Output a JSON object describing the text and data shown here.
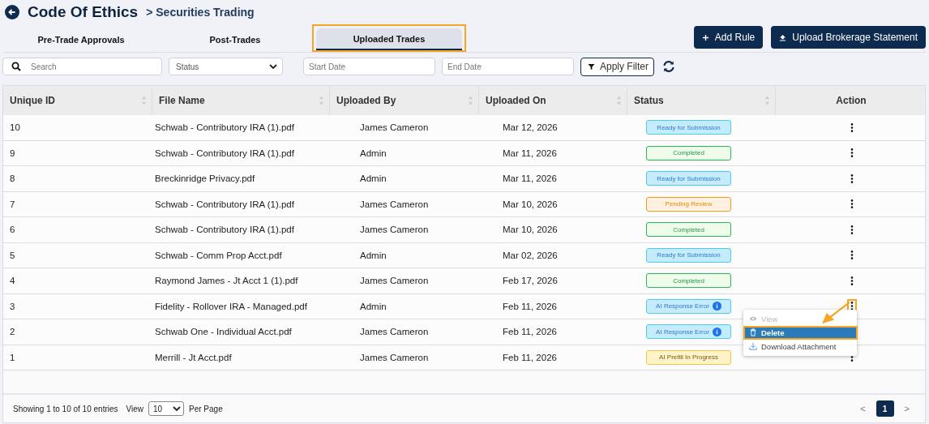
{
  "header": {
    "title": "Code Of Ethics",
    "breadcrumb": "> Securities Trading"
  },
  "tabs": [
    {
      "label": "Pre-Trade Approvals",
      "selected": false,
      "highlighted": false
    },
    {
      "label": "Post-Trades",
      "selected": false,
      "highlighted": false
    },
    {
      "label": "Uploaded Trades",
      "selected": true,
      "highlighted": true
    }
  ],
  "buttons": [
    {
      "kind": "add",
      "label": "Add Rule"
    },
    {
      "kind": "upload",
      "label": "Upload Brokerage Statement"
    }
  ],
  "filters": {
    "search": {
      "placeholder": "Search"
    },
    "status": {
      "value": "Status"
    },
    "start_date": {
      "placeholder": "Start Date"
    },
    "end_date": {
      "placeholder": "End Date"
    },
    "apply": "Apply Filter"
  },
  "table": {
    "columns": [
      {
        "label": "Unique ID",
        "sortable": true
      },
      {
        "label": "File Name",
        "sortable": true
      },
      {
        "label": "Uploaded By",
        "sortable": true
      },
      {
        "label": "Uploaded On",
        "sortable": true
      },
      {
        "label": "Status",
        "sortable": true
      },
      {
        "label": "Action",
        "sortable": false
      }
    ],
    "rows": [
      {
        "id": "10",
        "file": "Schwab - Contributory IRA (1).pdf",
        "by": "James Cameron",
        "on": "Mar 12, 2026",
        "status": {
          "kind": "ready",
          "label": "Ready for Submission"
        },
        "menu_highlighted": false
      },
      {
        "id": "9",
        "file": "Schwab - Contributory IRA (1).pdf",
        "by": "Admin",
        "on": "Mar 11, 2026",
        "status": {
          "kind": "completed",
          "label": "Completed"
        },
        "menu_highlighted": false
      },
      {
        "id": "8",
        "file": "Breckinridge Privacy.pdf",
        "by": "Admin",
        "on": "Mar 11, 2026",
        "status": {
          "kind": "ready",
          "label": "Ready for Submission"
        },
        "menu_highlighted": false
      },
      {
        "id": "7",
        "file": "Schwab - Contributory IRA (1).pdf",
        "by": "James Cameron",
        "on": "Mar 10, 2026",
        "status": {
          "kind": "pending",
          "label": "Pending Review"
        },
        "menu_highlighted": false
      },
      {
        "id": "6",
        "file": "Schwab - Contributory IRA (1).pdf",
        "by": "James Cameron",
        "on": "Mar 10, 2026",
        "status": {
          "kind": "completed",
          "label": "Completed"
        },
        "menu_highlighted": false
      },
      {
        "id": "5",
        "file": "Schwab - Comm Prop Acct.pdf",
        "by": "Admin",
        "on": "Mar 02, 2026",
        "status": {
          "kind": "ready",
          "label": "Ready for Submission"
        },
        "menu_highlighted": false
      },
      {
        "id": "4",
        "file": "Raymond James - Jt Acct 1 (1).pdf",
        "by": "James Cameron",
        "on": "Feb 17, 2026",
        "status": {
          "kind": "completed",
          "label": "Completed"
        },
        "menu_highlighted": false
      },
      {
        "id": "3",
        "file": "Fidelity - Rollover IRA - Managed.pdf",
        "by": "Admin",
        "on": "Feb 11, 2026",
        "status": {
          "kind": "error",
          "label": "AI Response Error"
        },
        "menu_highlighted": true
      },
      {
        "id": "2",
        "file": "Schwab One - Individual Acct.pdf",
        "by": "James Cameron",
        "on": "Feb 11, 2026",
        "status": {
          "kind": "error",
          "label": "AI Response Error"
        }
      },
      {
        "id": "1",
        "file": "Merrill - Jt Acct.pdf",
        "by": "James Cameron",
        "on": "Feb 11, 2026",
        "status": {
          "kind": "prefill",
          "label": "AI Prefill In Progress"
        },
        "menu_highlighted": false
      }
    ]
  },
  "action_menu": {
    "items": [
      {
        "kind": "view",
        "label": "View",
        "disabled": true,
        "selected": false,
        "highlighted": false
      },
      {
        "kind": "delete",
        "label": "Delete",
        "disabled": false,
        "selected": true,
        "highlighted": true
      },
      {
        "kind": "download",
        "label": "Download Attachment",
        "disabled": false,
        "selected": false,
        "highlighted": false
      }
    ]
  },
  "footer": {
    "summary": "Showing 1 to 10 of 10 entries",
    "view_label": "View",
    "per_page": "10",
    "per_page_label": "Per Page",
    "pages": [
      {
        "label": "1",
        "selected": true
      }
    ],
    "prev": "<",
    "next": ">"
  }
}
